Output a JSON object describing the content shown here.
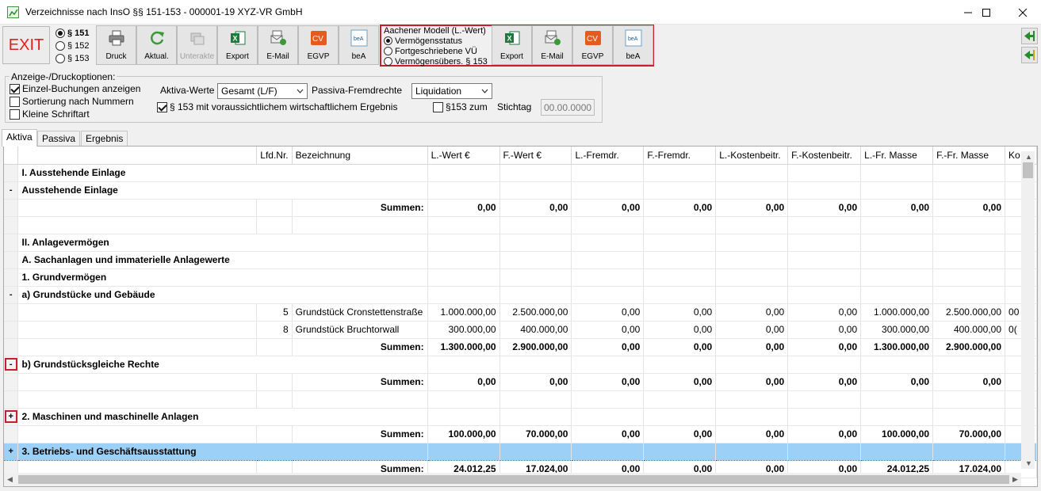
{
  "window": {
    "title": "Verzeichnisse nach InsO §§ 151-153 - 000001-19 XYZ-VR GmbH"
  },
  "toolbar": {
    "exit_label": "EXIT",
    "paragraph_options": [
      "§ 151",
      "§ 152",
      "§ 153"
    ],
    "buttons": [
      {
        "label": "Druck",
        "icon": "printer-icon"
      },
      {
        "label": "Aktual.",
        "icon": "refresh-icon"
      },
      {
        "label": "Unterakte",
        "icon": "subfile-icon",
        "disabled": true
      },
      {
        "label": "Export",
        "icon": "excel-icon"
      },
      {
        "label": "E-Mail",
        "icon": "email-icon"
      },
      {
        "label": "EGVP",
        "icon": "egvp-icon"
      },
      {
        "label": "beA",
        "icon": "bea-icon"
      }
    ],
    "aachen": {
      "title": "Aachener Modell  (L.-Wert)",
      "options": [
        "Vermögensstatus",
        "Fortgeschriebene VÜ",
        "Vermögensübers. § 153"
      ],
      "buttons": [
        {
          "label": "Export",
          "icon": "excel-icon"
        },
        {
          "label": "E-Mail",
          "icon": "email-icon"
        },
        {
          "label": "EGVP",
          "icon": "egvp-icon"
        },
        {
          "label": "beA",
          "icon": "bea-icon"
        }
      ]
    }
  },
  "options": {
    "legend": "Anzeige-/Druckoptionen:",
    "einzel": "Einzel-Buchungen anzeigen",
    "sortierung": "Sortierung nach Nummern",
    "klein": "Kleine Schriftart",
    "aktiva_label": "Aktiva-Werte",
    "aktiva_value": "Gesamt (L/F)",
    "passiva_label": "Passiva-Fremdrechte",
    "passiva_value": "Liquidation",
    "p153_erg": "§ 153 mit voraussichtlichem wirtschaftlichem Ergebnis",
    "p153_zum": "§153 zum",
    "stichtag_label": "Stichtag",
    "stichtag_value": "00.00.0000"
  },
  "tabs": [
    "Aktiva",
    "Passiva",
    "Ergebnis"
  ],
  "table": {
    "headers": [
      "",
      "Lfd.Nr.",
      "Bezeichnung",
      "L.-Wert €",
      "F.-Wert €",
      "L.-Fremdr.",
      "F.-Fremdr.",
      "L.-Kostenbeitr.",
      "F.-Kostenbeitr.",
      "L.-Fr. Masse",
      "F.-Fr. Masse",
      "Ko"
    ],
    "rows": [
      {
        "type": "sect",
        "exp": "",
        "label": "I. Ausstehende Einlage",
        "cells": []
      },
      {
        "type": "sect",
        "exp": "-",
        "label": "Ausstehende Einlage",
        "cells": []
      },
      {
        "type": "summe",
        "exp": "",
        "lfd": "",
        "bez": "Summen:",
        "cells": [
          "0,00",
          "0,00",
          "0,00",
          "0,00",
          "0,00",
          "0,00",
          "0,00",
          "0,00",
          ""
        ]
      },
      {
        "type": "empty",
        "exp": "",
        "cells": []
      },
      {
        "type": "sect",
        "exp": "",
        "label": "II. Anlagevermögen",
        "cells": []
      },
      {
        "type": "sect",
        "exp": "",
        "label": "A. Sachanlagen und immaterielle Anlagewerte",
        "cells": []
      },
      {
        "type": "sect",
        "exp": "",
        "label": "1. Grundvermögen",
        "cells": []
      },
      {
        "type": "sect",
        "exp": "-",
        "label": "a) Grundstücke und Gebäude",
        "cells": []
      },
      {
        "type": "item",
        "exp": "",
        "lfd": "5",
        "bez": "Grundstück Cronstettenstraße",
        "cells": [
          "1.000.000,00",
          "2.500.000,00",
          "0,00",
          "0,00",
          "0,00",
          "0,00",
          "1.000.000,00",
          "2.500.000,00",
          "00"
        ]
      },
      {
        "type": "item",
        "exp": "",
        "lfd": "8",
        "bez": "Grundstück Bruchtorwall",
        "cells": [
          "300.000,00",
          "400.000,00",
          "0,00",
          "0,00",
          "0,00",
          "0,00",
          "300.000,00",
          "400.000,00",
          "0("
        ]
      },
      {
        "type": "summe",
        "exp": "",
        "lfd": "",
        "bez": "Summen:",
        "cells": [
          "1.300.000,00",
          "2.900.000,00",
          "0,00",
          "0,00",
          "0,00",
          "0,00",
          "1.300.000,00",
          "2.900.000,00",
          ""
        ]
      },
      {
        "type": "sect",
        "exp": "-",
        "expred": true,
        "label": "b) Grundstücksgleiche Rechte",
        "cells": []
      },
      {
        "type": "summe",
        "exp": "",
        "lfd": "",
        "bez": "Summen:",
        "cells": [
          "0,00",
          "0,00",
          "0,00",
          "0,00",
          "0,00",
          "0,00",
          "0,00",
          "0,00",
          ""
        ]
      },
      {
        "type": "empty",
        "exp": "",
        "cells": []
      },
      {
        "type": "sect",
        "exp": "+",
        "expred": true,
        "label": "2. Maschinen und maschinelle Anlagen",
        "cells": []
      },
      {
        "type": "summe",
        "exp": "",
        "lfd": "",
        "bez": "Summen:",
        "cells": [
          "100.000,00",
          "70.000,00",
          "0,00",
          "0,00",
          "0,00",
          "0,00",
          "100.000,00",
          "70.000,00",
          ""
        ]
      },
      {
        "type": "sect",
        "exp": "+",
        "selected": true,
        "label": "3. Betriebs- und Geschäftsausstattung",
        "cells": []
      },
      {
        "type": "summe",
        "exp": "",
        "lfd": "",
        "bez": "Summen:",
        "cells": [
          "24.012,25",
          "17.024,00",
          "0,00",
          "0,00",
          "0,00",
          "0,00",
          "24.012,25",
          "17.024,00",
          ""
        ]
      }
    ]
  }
}
